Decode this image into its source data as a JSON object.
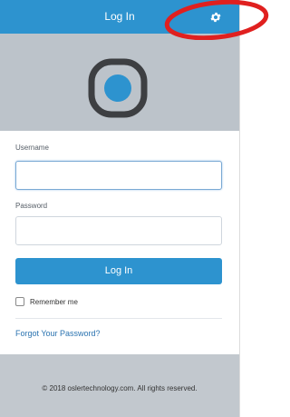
{
  "header": {
    "title": "Log In",
    "settings_icon": "gear-icon"
  },
  "branding": {
    "logo_icon": "app-logo-icon"
  },
  "form": {
    "username_label": "Username",
    "username_value": "",
    "password_label": "Password",
    "password_value": "",
    "login_button": "Log In",
    "remember_label": "Remember me",
    "remember_checked": false,
    "forgot_link": "Forgot Your Password?"
  },
  "footer": {
    "copyright": "© 2018 oslertechnology.com. All rights reserved."
  },
  "colors": {
    "primary": "#2d93cf",
    "banner": "#bcc3ca",
    "footer": "#c2c8ce",
    "link": "#2a73b0",
    "annotation": "#e0201f"
  }
}
